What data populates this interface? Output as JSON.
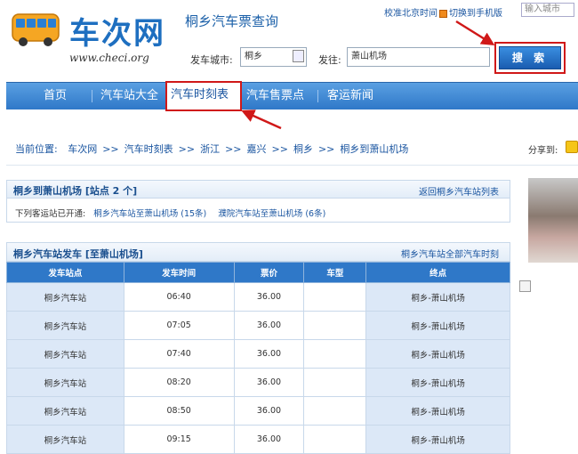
{
  "header": {
    "logo_text": "车次网",
    "logo_url": "www.checi.org",
    "site_title": "桐乡汽车票查询",
    "time_link": "校准北京时间",
    "mobile_link": "切换到手机版",
    "city_placeholder": "输入城市"
  },
  "search": {
    "from_label": "发车城市:",
    "from_value": "桐乡",
    "to_label": "发往:",
    "to_value": "萧山机场",
    "button_label": "搜 索"
  },
  "nav": {
    "items": [
      "首页",
      "汽车站大全",
      "汽车时刻表",
      "汽车售票点",
      "客运新闻"
    ],
    "active_index": 2
  },
  "breadcrumb": {
    "label": "当前位置:",
    "items": [
      "车次网",
      "汽车时刻表",
      "浙江",
      "嘉兴",
      "桐乡",
      "桐乡到萧山机场"
    ],
    "share_label": "分享到:"
  },
  "stations_panel": {
    "title": "桐乡到萧山机场 [站点 2 个]",
    "right_link": "返回桐乡汽车站列表",
    "intro": "下列客运站已开通:",
    "links": [
      "桐乡汽车站至萧山机场 (15条)",
      "濮院汽车站至萧山机场 (6条)"
    ]
  },
  "schedule_panel": {
    "title": "桐乡汽车站发车 [至萧山机场]",
    "right_link": "桐乡汽车站全部汽车时刻",
    "columns": [
      "发车站点",
      "发车时间",
      "票价",
      "车型",
      "终点"
    ],
    "rows": [
      [
        "桐乡汽车站",
        "06:40",
        "36.00",
        "",
        "桐乡-萧山机场"
      ],
      [
        "桐乡汽车站",
        "07:05",
        "36.00",
        "",
        "桐乡-萧山机场"
      ],
      [
        "桐乡汽车站",
        "07:40",
        "36.00",
        "",
        "桐乡-萧山机场"
      ],
      [
        "桐乡汽车站",
        "08:20",
        "36.00",
        "",
        "桐乡-萧山机场"
      ],
      [
        "桐乡汽车站",
        "08:50",
        "36.00",
        "",
        "桐乡-萧山机场"
      ],
      [
        "桐乡汽车站",
        "09:15",
        "36.00",
        "",
        "桐乡-萧山机场"
      ]
    ]
  },
  "colors": {
    "brand_blue": "#1e6fc0",
    "nav_blue": "#2f78c8",
    "highlight_red": "#d01818",
    "row_blue": "#dce8f7"
  }
}
